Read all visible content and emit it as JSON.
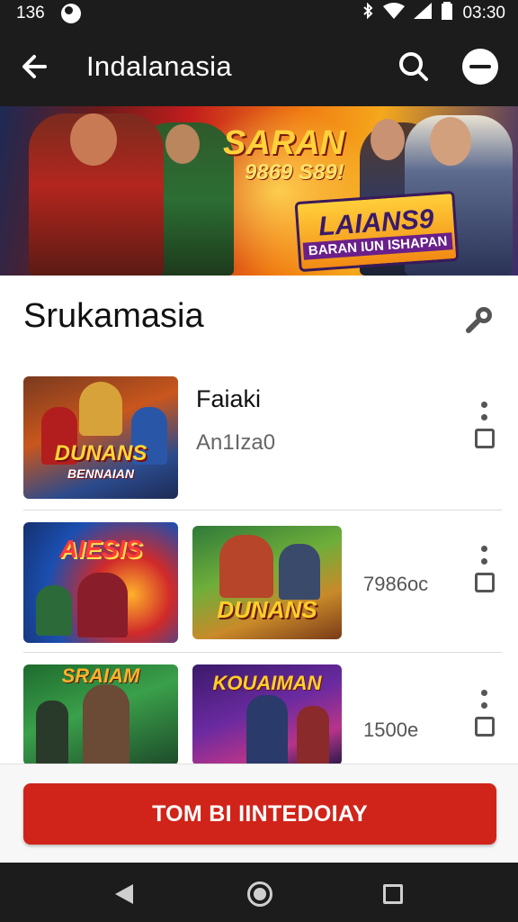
{
  "status_bar": {
    "left_text": "136",
    "time": "03:30"
  },
  "app_bar": {
    "title": "Indalanasia"
  },
  "banner": {
    "headline": "SARAN",
    "subline": "9869 S89!",
    "logo_title": "LAIANS9",
    "logo_sub": "BARAN IUN ISHAPAN"
  },
  "section": {
    "title": "Srukamasia"
  },
  "rows": [
    {
      "title": "Faiaki",
      "subtitle": "An1Iza0",
      "thumbs": [
        {
          "label": "DUNANS",
          "sublabel": "BENNAIAN"
        }
      ]
    },
    {
      "value": "7986oc",
      "thumbs": [
        {
          "label": "AIESIS"
        },
        {
          "label": "DUNANS"
        }
      ]
    },
    {
      "value": "1500e",
      "thumbs": [
        {
          "label": "SRAIAM"
        },
        {
          "label": "KOUAIMAN"
        }
      ]
    }
  ],
  "cta": {
    "label": "TOM BI IINTEDOIAY"
  },
  "colors": {
    "app_bar": "#1c1c1c",
    "accent": "#d0241a",
    "background": "#ffffff"
  }
}
